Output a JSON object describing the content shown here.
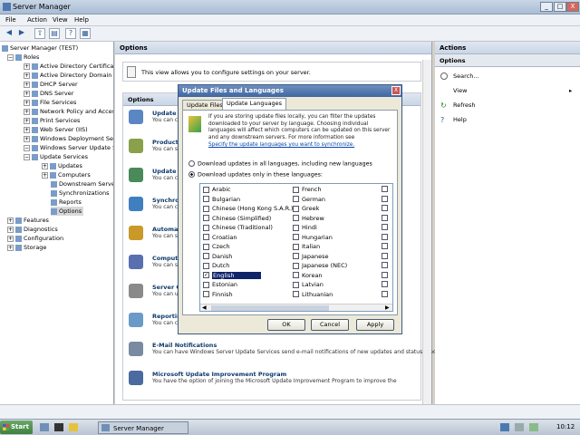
{
  "window": {
    "title": "Server Manager",
    "min": "_",
    "max": "□",
    "close": "X"
  },
  "menu": [
    "File",
    "Action",
    "View",
    "Help"
  ],
  "tree": {
    "root": "Server Manager (TEST)",
    "roles": "Roles",
    "role_items": [
      "Active Directory Certificate",
      "Active Directory Domain Se",
      "DHCP Server",
      "DNS Server",
      "File Services",
      "Network Policy and Access",
      "Print Services",
      "Web Server (IIS)",
      "Windows Deployment Servi",
      "Windows Server Update Se"
    ],
    "wsus_items": [
      "Update Services",
      "Updates",
      "Computers",
      "Downstream Servers",
      "Synchronizations",
      "Reports",
      "Options"
    ],
    "bottom_items": [
      "Features",
      "Diagnostics",
      "Configuration",
      "Storage"
    ]
  },
  "center": {
    "header": "Options",
    "info": "This view allows you to configure settings on your server.",
    "subheader": "Options",
    "options": [
      {
        "title": "Update Source and Proxy Server",
        "desc": "You can choose whether this Windows Server Update Services server synchronizes from"
      },
      {
        "title": "Products and Classifications",
        "desc": "You can specify the products for which you want updates"
      },
      {
        "title": "Update Files and Languages",
        "desc": "You can choose whether to store update files"
      },
      {
        "title": "Synchronization Schedule",
        "desc": "You can choose to synchronize manually"
      },
      {
        "title": "Automatic Approvals",
        "desc": "You can specify how to automatically approve"
      },
      {
        "title": "Computers",
        "desc": "You can specify how to assign computers"
      },
      {
        "title": "Server Cleanup Wizard",
        "desc": "You can use the server cleanup wizard"
      },
      {
        "title": "Reporting Rollup",
        "desc": "You can choose to have replica downstream servers roll up computer and update status"
      },
      {
        "title": "E-Mail Notifications",
        "desc": "You can have Windows Server Update Services send e-mail notifications of new updates and status reports."
      },
      {
        "title": "Microsoft Update Improvement Program",
        "desc": "You have the option of joining the Microsoft Update Improvement Program to improve the"
      }
    ]
  },
  "actions": {
    "header": "Actions",
    "subheader": "Options",
    "items": [
      "Search...",
      "View",
      "Refresh",
      "Help"
    ]
  },
  "dialog": {
    "title": "Update Files and Languages",
    "close": "X",
    "tabs": [
      "Update Files",
      "Update Languages"
    ],
    "info": "If you are storing update files locally, you can filter the updates downloaded to your server by language. Choosing individual languages will affect which computers can be updated on this server and any downstream servers. For more information see",
    "link": "Specify the update languages you want to synchronize.",
    "radio_all": "Download updates in all languages, including new languages",
    "radio_only": "Download updates only in these languages:",
    "col1": [
      "Arabic",
      "Bulgarian",
      "Chinese (Hong Kong S.A.R.)",
      "Chinese (Simplified)",
      "Chinese (Traditional)",
      "Croatian",
      "Czech",
      "Danish",
      "Dutch",
      "English",
      "Estonian",
      "Finnish"
    ],
    "col2": [
      "French",
      "German",
      "Greek",
      "Hebrew",
      "Hindi",
      "Hungarian",
      "Italian",
      "Japanese",
      "Japanese (NEC)",
      "Korean",
      "Latvian",
      "Lithuanian"
    ],
    "ok": "OK",
    "cancel": "Cancel",
    "apply": "Apply"
  },
  "taskbar": {
    "start": "Start",
    "task": "Server Manager",
    "clock": "10:12"
  }
}
